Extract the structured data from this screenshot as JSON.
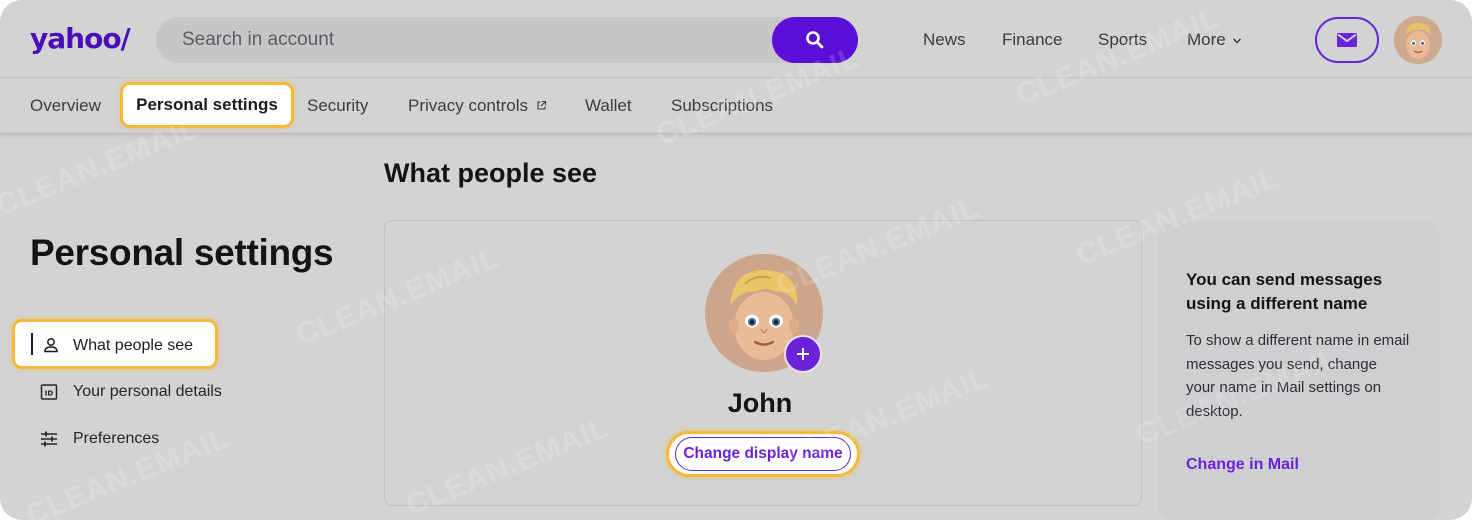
{
  "header": {
    "logo": "yahoo/",
    "search_placeholder": "Search in account",
    "nav": [
      "News",
      "Finance",
      "Sports",
      "More"
    ]
  },
  "tabs": [
    {
      "label": "Overview"
    },
    {
      "label": "Personal settings",
      "active": true
    },
    {
      "label": "Security"
    },
    {
      "label": "Privacy controls"
    },
    {
      "label": "Wallet"
    },
    {
      "label": "Subscriptions"
    }
  ],
  "sidebar": {
    "title": "Personal settings",
    "items": [
      {
        "label": "What people see",
        "icon": "person-icon",
        "active": true
      },
      {
        "label": "Your personal details",
        "icon": "id-card-icon"
      },
      {
        "label": "Preferences",
        "icon": "sliders-icon"
      }
    ]
  },
  "main": {
    "section_title": "What people see",
    "display_name": "John",
    "change_button": "Change display name"
  },
  "info_card": {
    "title": "You can send messages using a different name",
    "body": "To show a different name in email messages you send, change your name in Mail settings on desktop.",
    "link": "Change in Mail"
  },
  "watermark": "CLEAN.EMAIL",
  "colors": {
    "accent": "#6a23d8",
    "brand": "#4a10b8",
    "highlight": "#f5b93a"
  }
}
